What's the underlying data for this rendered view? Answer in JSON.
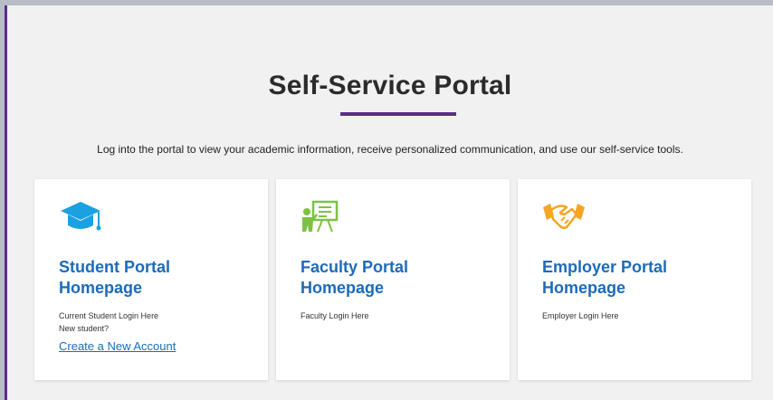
{
  "page": {
    "title": "Self-Service Portal",
    "intro": "Log into the portal to view your academic information, receive personalized communication, and use our self-service tools."
  },
  "cards": [
    {
      "title": "Student Portal Homepage",
      "lines": [
        "Current Student Login Here",
        "New student?"
      ],
      "link": "Create a New Account",
      "icon": "graduation-cap-icon",
      "icon_color": "#1ba1e2"
    },
    {
      "title": "Faculty Portal Homepage",
      "lines": [
        "Faculty Login Here"
      ],
      "icon": "teacher-board-icon",
      "icon_color": "#7dc242"
    },
    {
      "title": "Employer Portal Homepage",
      "lines": [
        "Employer Login Here"
      ],
      "icon": "handshake-icon",
      "icon_color": "#f5a623"
    }
  ],
  "colors": {
    "accent": "#5b2d8c",
    "link": "#1e6bb8"
  }
}
